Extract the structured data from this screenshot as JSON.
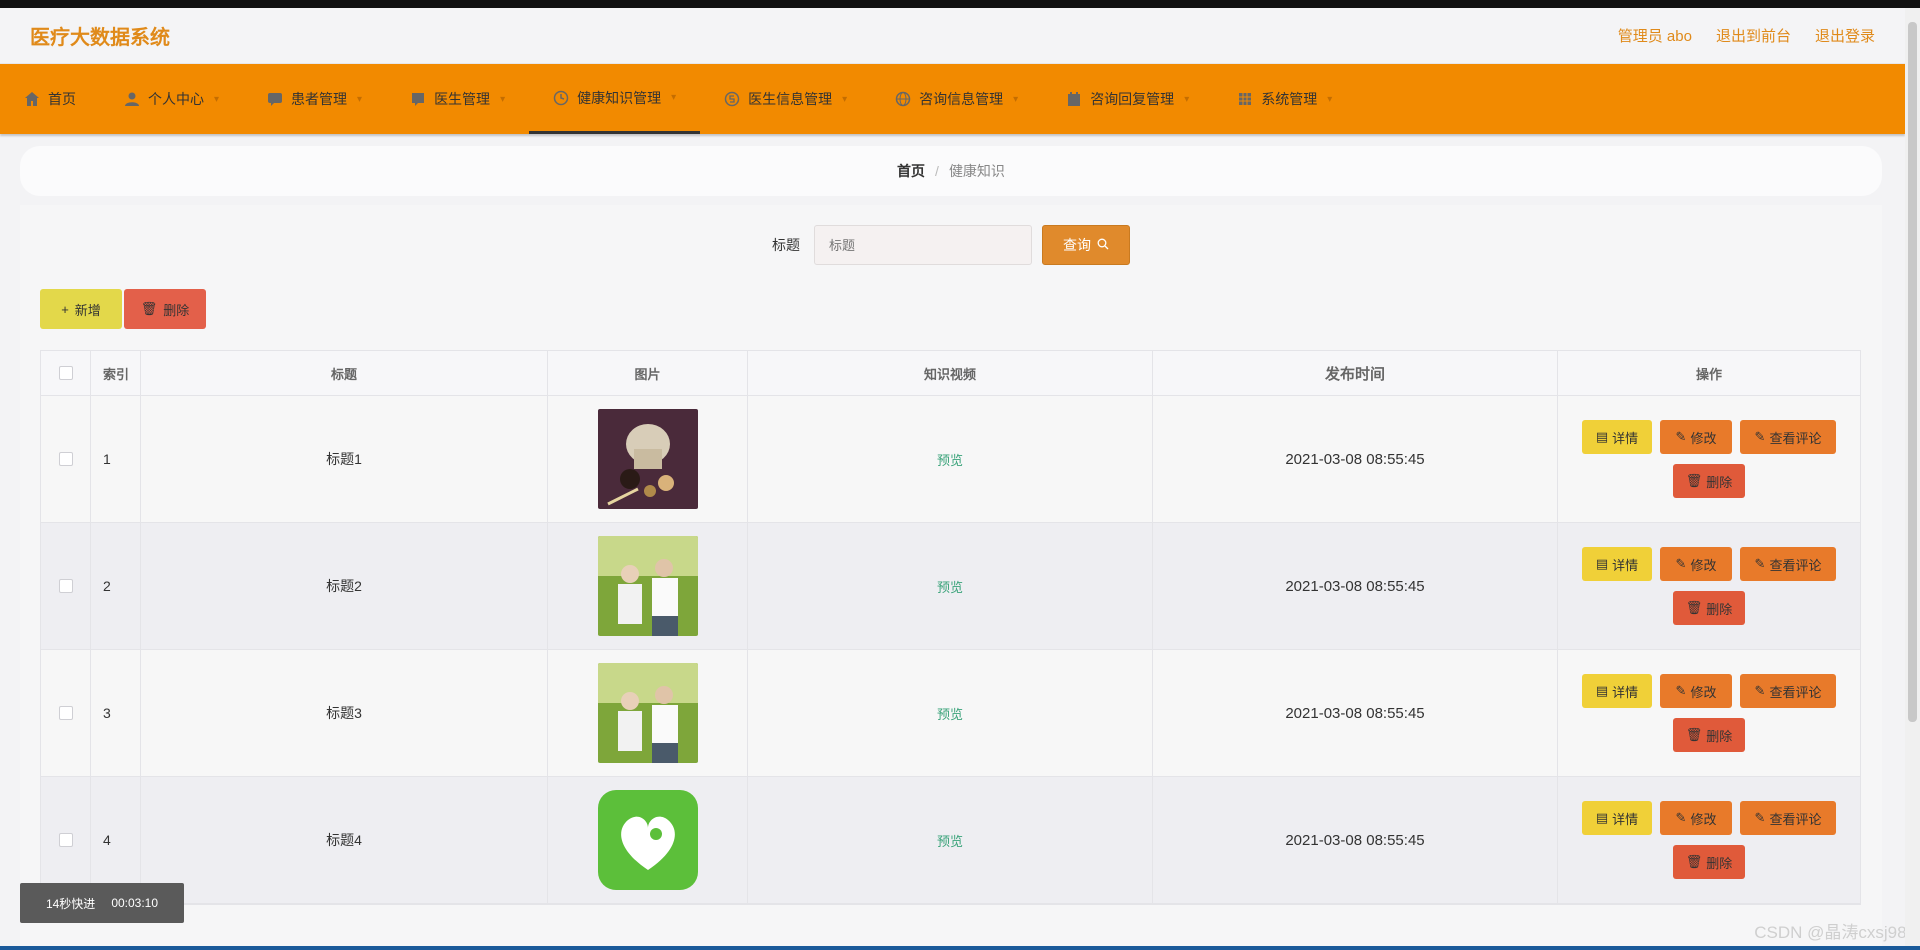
{
  "header": {
    "brand": "医疗大数据系统",
    "links": [
      "管理员 abo",
      "退出到前台",
      "退出登录"
    ]
  },
  "nav": {
    "items": [
      {
        "label": "首页",
        "icon": "home-icon"
      },
      {
        "label": "个人中心",
        "icon": "user-icon"
      },
      {
        "label": "患者管理",
        "icon": "chat-icon"
      },
      {
        "label": "医生管理",
        "icon": "message-icon"
      },
      {
        "label": "健康知识管理",
        "icon": "clock-icon"
      },
      {
        "label": "医生信息管理",
        "icon": "dollar-icon"
      },
      {
        "label": "咨询信息管理",
        "icon": "globe-icon"
      },
      {
        "label": "咨询回复管理",
        "icon": "calendar-icon"
      },
      {
        "label": "系统管理",
        "icon": "grid-icon"
      }
    ]
  },
  "breadcrumb": {
    "home": "首页",
    "sep": "/",
    "current": "健康知识"
  },
  "search": {
    "label": "标题",
    "placeholder": "标题",
    "button": "查询"
  },
  "actions": {
    "add": "新增",
    "delete": "删除"
  },
  "table": {
    "headers": [
      "",
      "索引",
      "标题",
      "图片",
      "知识视频",
      "发布时间",
      "操作"
    ],
    "rows": [
      {
        "index": "1",
        "title": "标题1",
        "image": "herbs-image",
        "video": "预览",
        "time": "2021-03-08 08:55:45"
      },
      {
        "index": "2",
        "title": "标题2",
        "image": "elderly-couple-image",
        "video": "预览",
        "time": "2021-03-08 08:55:45"
      },
      {
        "index": "3",
        "title": "标题3",
        "image": "elderly-couple-image",
        "video": "预览",
        "time": "2021-03-08 08:55:45"
      },
      {
        "index": "4",
        "title": "标题4",
        "image": "green-heart-logo",
        "video": "预览",
        "time": "2021-03-08 08:55:45"
      }
    ],
    "ops": {
      "detail": "详情",
      "edit": "修改",
      "comment": "查看评论",
      "delete": "删除"
    }
  },
  "playback": {
    "label": "14秒快进",
    "time": "00:03:10"
  },
  "watermark": "CSDN @晶涛cxsj985",
  "colors": {
    "accent": "#f28a00",
    "brand": "#e08a1a",
    "preview": "#3aa37a"
  }
}
